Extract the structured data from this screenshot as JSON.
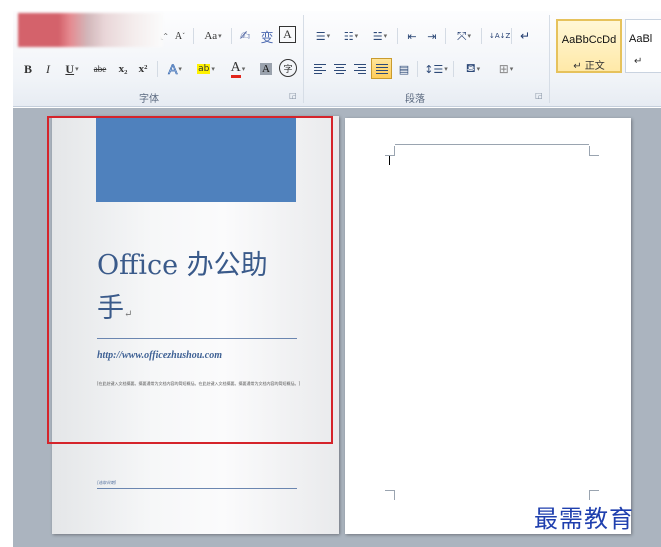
{
  "ribbon": {
    "font_group": {
      "label": "字体",
      "grow_font": "A",
      "shrink_font": "A",
      "change_case": "Aa",
      "phonetic_guide": "变",
      "character_border": "A",
      "bold": "B",
      "italic": "I",
      "underline": "U",
      "strikethrough": "abe",
      "subscript": "x₂",
      "superscript": "x²",
      "text_effects": "A",
      "highlight": "ab",
      "font_color": "A",
      "character_shading": "A",
      "enclose_characters": "字"
    },
    "paragraph_group": {
      "label": "段落",
      "sort": "↓A↓Z"
    },
    "styles": [
      {
        "sample": "AaBbCcDd",
        "name": "↵ 正文",
        "selected": true
      },
      {
        "sample": "AaBl",
        "name": "↵"
      }
    ]
  },
  "document": {
    "cover": {
      "title_line1": "Office 办公助",
      "title_line2": "手",
      "url": "http://www.officezhushou.com",
      "abstract": "[在此处键入文档摘要。摘要通常为文档内容的简短概括。在此处键入文档摘要。摘要通常为文档内容的简短概括。]",
      "date": "[选取日期]"
    }
  },
  "watermark": "最需教育",
  "colors": {
    "cover_block": "#4f81bd",
    "selection_rect": "#d5242b",
    "watermark": "#1f3fae"
  }
}
